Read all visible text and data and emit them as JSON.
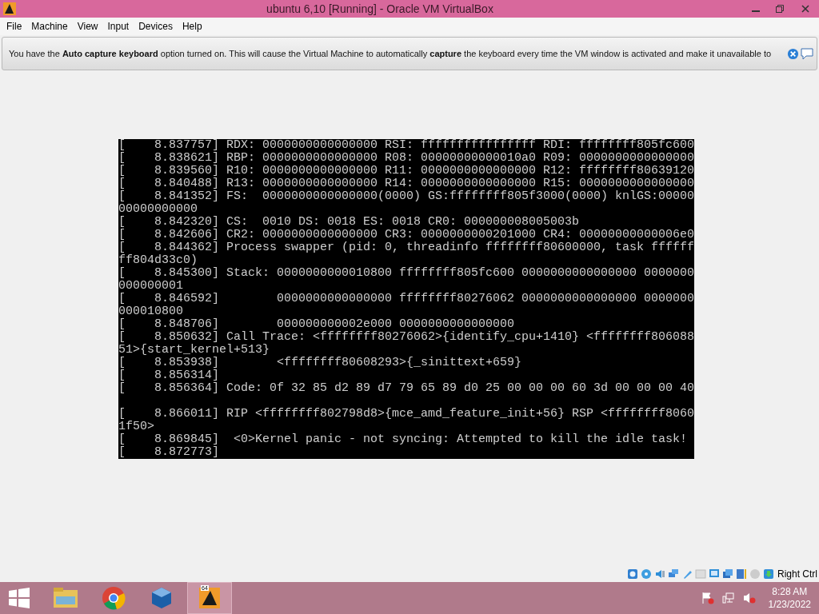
{
  "window": {
    "title": "ubuntu 6,10 [Running] - Oracle VM VirtualBox"
  },
  "menu": [
    "File",
    "Machine",
    "View",
    "Input",
    "Devices",
    "Help"
  ],
  "notice": {
    "text": "You have the **Auto capture keyboard** option turned on. This will cause the Virtual Machine to automatically **capture** the keyboard every time the VM window is activated and make it unavailable to"
  },
  "console": {
    "lines": [
      {
        "kind": "text",
        "text": "[    8.837757] RDX: 0000000000000000 RSI: ffffffffffffffff RDI: ffffffff805fc600"
      },
      {
        "kind": "text",
        "text": "[    8.838621] RBP: 0000000000000000 R08: 00000000000010a0 R09: 0000000000000000"
      },
      {
        "kind": "text",
        "text": "[    8.839560] R10: 0000000000000000 R11: 0000000000000000 R12: ffffffff80639120"
      },
      {
        "kind": "text",
        "text": "[    8.840488] R13: 0000000000000000 R14: 0000000000000000 R15: 0000000000000000"
      },
      {
        "kind": "text",
        "text": "[    8.841352] FS:  0000000000000000(0000) GS:ffffffff805f3000(0000) knlGS:00000"
      },
      {
        "kind": "text",
        "text": "00000000000"
      },
      {
        "kind": "text",
        "text": "[    8.842320] CS:  0010 DS: 0018 ES: 0018 CR0: 000000008005003b"
      },
      {
        "kind": "text",
        "text": "[    8.842606] CR2: 0000000000000000 CR3: 0000000000201000 CR4: 00000000000006e0"
      },
      {
        "kind": "text",
        "text": "[    8.844362] Process swapper (pid: 0, threadinfo ffffffff80600000, task ffffff"
      },
      {
        "kind": "text",
        "text": "ff804d33c0)"
      },
      {
        "kind": "text",
        "text": "[    8.845300] Stack: 0000000000010800 ffffffff805fc600 0000000000000000 0000000"
      },
      {
        "kind": "text",
        "text": "000000001"
      },
      {
        "kind": "text",
        "text": "[    8.846592]        0000000000000000 ffffffff80276062 0000000000000000 0000000"
      },
      {
        "kind": "text",
        "text": "000010800"
      },
      {
        "kind": "text",
        "text": "[    8.848706]        000000000002e000 0000000000000000"
      },
      {
        "kind": "text",
        "text": "[    8.850632] Call Trace: <ffffffff80276062>{identify_cpu+1410} <ffffffff806088"
      },
      {
        "kind": "text",
        "text": "51>{start_kernel+513}"
      },
      {
        "kind": "text",
        "text": "[    8.853938]        <ffffffff80608293>{_sinittext+659}"
      },
      {
        "kind": "text",
        "text": "[    8.856314]"
      },
      {
        "kind": "text",
        "text": "[    8.856364] Code: 0f 32 85 d2 89 d7 79 65 89 d0 25 00 00 00 60 3d 00 00 00 40"
      },
      {
        "kind": "blank"
      },
      {
        "kind": "text",
        "text": "[    8.866011] RIP <ffffffff802798d8>{mce_amd_feature_init+56} RSP <ffffffff8060"
      },
      {
        "kind": "text",
        "text": "1f50>"
      },
      {
        "kind": "text",
        "text": "[    8.869845]  <0>Kernel panic - not syncing: Attempted to kill the idle task!"
      },
      {
        "kind": "text",
        "text": "[    8.872773]"
      }
    ]
  },
  "status_bar": {
    "host_key": "Right Ctrl"
  },
  "taskbar": {
    "apps": [
      {
        "kind": "explorer",
        "active": false
      },
      {
        "kind": "chrome",
        "active": false
      },
      {
        "kind": "virtualbox",
        "active": false
      },
      {
        "kind": "vm",
        "active": true,
        "badge": "64"
      }
    ],
    "clock": {
      "time": "8:28 AM",
      "date": "1/23/2022"
    }
  }
}
